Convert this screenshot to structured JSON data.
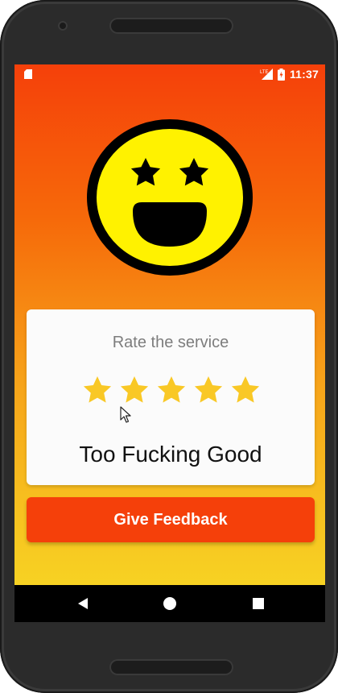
{
  "status_bar": {
    "time": "11:37",
    "icons": [
      "sd-card-icon",
      "lte-signal-icon",
      "battery-charging-icon"
    ],
    "network_label": "LTE"
  },
  "rating_card": {
    "title": "Rate the service",
    "rating": 5,
    "max_rating": 5,
    "rating_label": "Too Fucking Good"
  },
  "feedback_button": {
    "label": "Give Feedback"
  },
  "navigation": {
    "buttons": [
      "back-icon",
      "home-icon",
      "recents-icon"
    ]
  },
  "colors": {
    "accent": "#f5400a",
    "gradient_top": "#f5400a",
    "gradient_bottom": "#f7d223",
    "star": "#f9c826",
    "emoji_face": "#fff200",
    "card_background": "#fbfbfb"
  }
}
